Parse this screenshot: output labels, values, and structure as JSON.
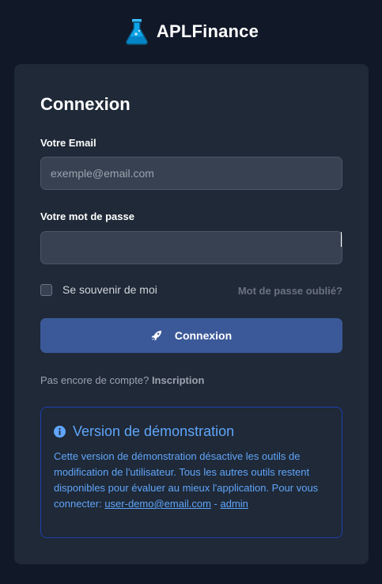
{
  "brand": {
    "name": "APLFinance",
    "logo_icon": "flask-icon"
  },
  "login": {
    "title": "Connexion",
    "email_label": "Votre Email",
    "email_placeholder": "exemple@email.com",
    "email_value": "",
    "password_label": "Votre mot de passe",
    "password_value": "",
    "remember_label": "Se souvenir de moi",
    "remember_checked": false,
    "forgot_label": "Mot de passe oublié?",
    "submit_label": "Connexion",
    "submit_icon": "rocket-icon",
    "signup_prompt": "Pas encore de compte?",
    "signup_link": "Inscription"
  },
  "demo": {
    "icon": "info-icon",
    "title": "Version de démonstration",
    "text": "Cette version de démonstration désactive les outils de modification de l'utilisateur. Tous les autres outils restent disponibles pour évaluer au mieux l'application. Pour vous connecter:",
    "email_link": "user-demo@email.com",
    "separator": "-",
    "password_link": "admin"
  },
  "colors": {
    "background": "#111827",
    "card": "#1f2937",
    "input": "#374151",
    "button": "#3b5998",
    "accent": "#60a5fa",
    "demo_border": "#1e40af"
  }
}
